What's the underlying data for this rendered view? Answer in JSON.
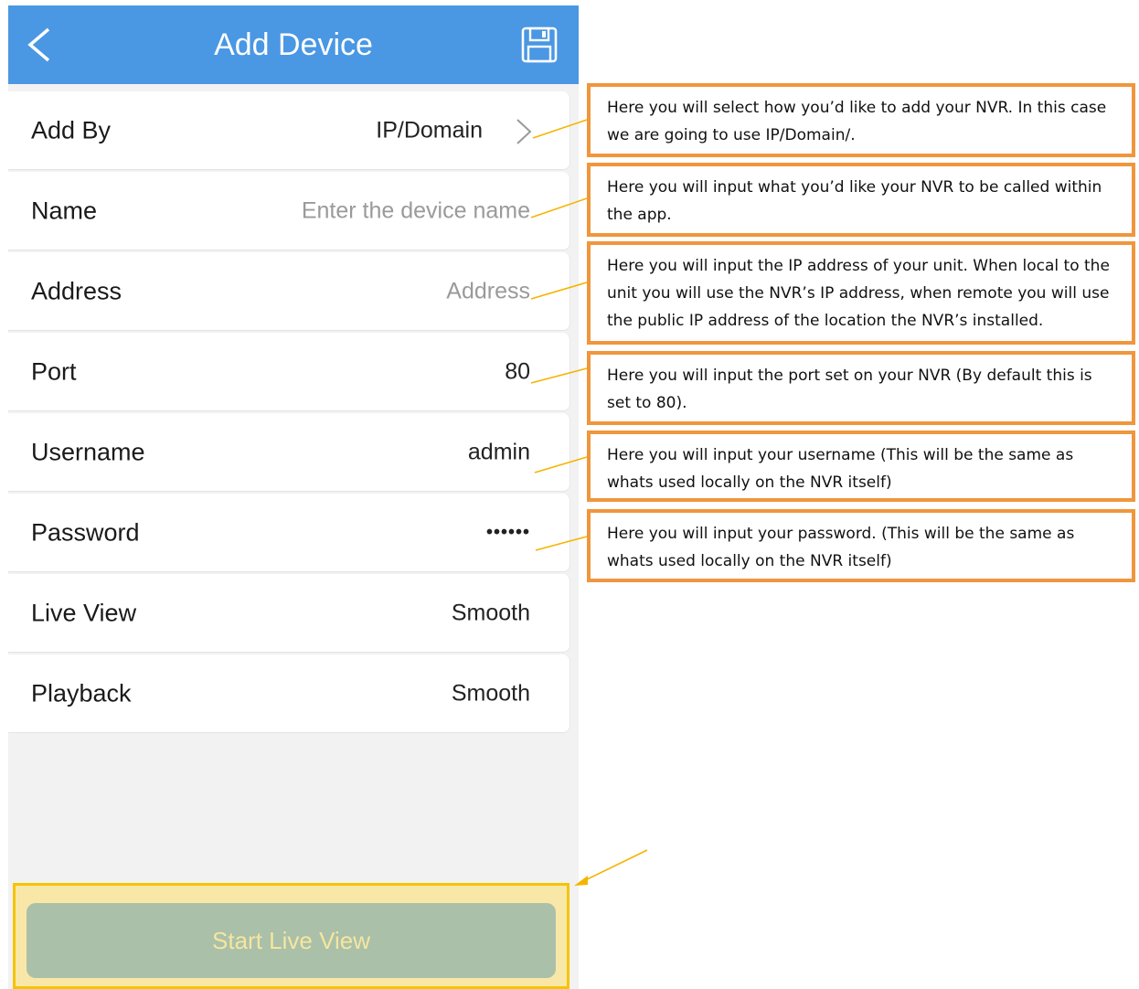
{
  "header": {
    "title": "Add Device",
    "back_icon": "chevron-left-icon",
    "save_icon": "floppy-disk-icon"
  },
  "form": {
    "add_by": {
      "label": "Add By",
      "value": "IP/Domain"
    },
    "name": {
      "label": "Name",
      "placeholder": "Enter the device name"
    },
    "address": {
      "label": "Address",
      "placeholder": "Address"
    },
    "port": {
      "label": "Port",
      "value": "80"
    },
    "username": {
      "label": "Username",
      "value": "admin"
    },
    "password": {
      "label": "Password",
      "value": "••••••"
    },
    "live_view": {
      "label": "Live View",
      "value": "Smooth"
    },
    "playback": {
      "label": "Playback",
      "value": "Smooth"
    }
  },
  "start_button": {
    "label": "Start Live View"
  },
  "annotations": {
    "add_by": "Here you will select how you’d like to add your NVR.  In this case we are going to use IP/Domain/.",
    "name": "Here you will input what you’d like your NVR to be called within the app.",
    "address": "Here you will input the IP address of your unit.  When local to the unit you will use the NVR’s IP address, when remote you will use the public IP address of the location the NVR’s installed.",
    "port": "Here you will input the port set on your NVR (By default this is set to 80).",
    "username": "Here you will input your username (This will be the same as whats used locally on the NVR itself)",
    "password": "Here you will input your password. (This will be the same as whats used locally on the NVR itself)"
  },
  "colors": {
    "header": "#4a97e3",
    "note_border": "#f0963c",
    "highlight": "#f5c400",
    "button": "#aac0a8"
  }
}
